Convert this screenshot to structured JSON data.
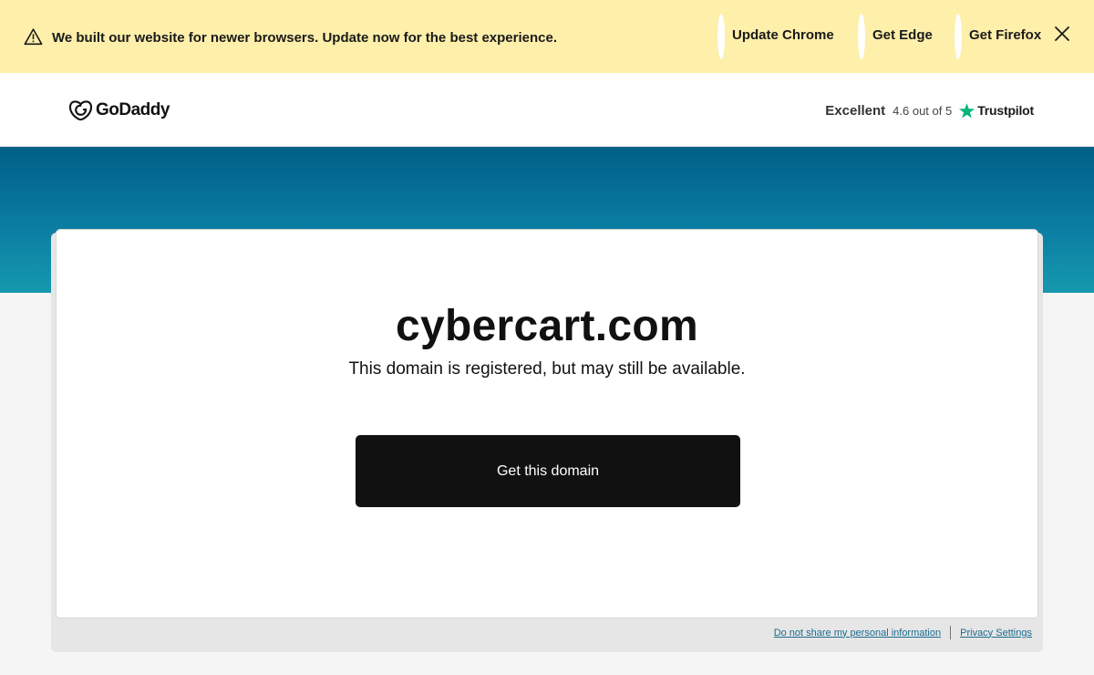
{
  "banner": {
    "message": "We built our website for newer browsers. Update now for the best experience.",
    "links": [
      {
        "label": "Update Chrome"
      },
      {
        "label": "Get Edge"
      },
      {
        "label": "Get Firefox"
      }
    ],
    "warning_icon": "warning-triangle-icon",
    "close_icon": "close-icon",
    "background_color": "#feefaa"
  },
  "header": {
    "logo_text": "GoDaddy",
    "trustpilot": {
      "rating_word": "Excellent",
      "score_text": "4.6 out of 5",
      "brand": "Trustpilot",
      "star_color": "#00b67a"
    }
  },
  "main": {
    "domain": "cybercart.com",
    "status_text": "This domain is registered, but may still be available.",
    "cta_label": "Get this domain",
    "hero_color": "#0a7aa0"
  },
  "footer": {
    "links": [
      {
        "label": "Do not share my personal information"
      },
      {
        "label": "Privacy Settings"
      }
    ]
  }
}
